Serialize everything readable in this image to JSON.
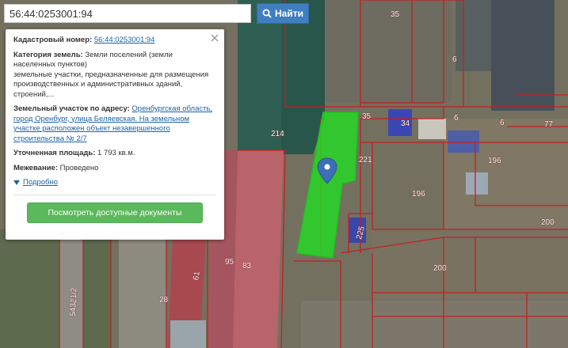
{
  "search": {
    "value": "56:44:0253001:94",
    "button_label": "Найти",
    "button_icon": "search-icon"
  },
  "popup": {
    "cadastral_label": "Кадастровый номер:",
    "cadastral_number": "56:44:0253001:94",
    "category_label": "Категория земель:",
    "category_value": "Земли поселений (земли населенных пунктов)",
    "category_detail": "земельные участки, предназначенные для размещения производственных и административных зданий, строений,...",
    "address_label": "Земельный участок по адресу:",
    "address_value": "Оренбургская область, город Оренбург, улица Беляевская. На земельном участке расположен объект незавершенного строительства № 2/7",
    "area_label": "Уточненная площадь:",
    "area_value": "1 793 кв.м.",
    "survey_label": "Межевание:",
    "survey_value": "Проведено",
    "more_label": "Подробно",
    "documents_button": "Посмотреть доступные документы",
    "close_icon": "close-icon"
  },
  "map": {
    "marker_icon": "map-marker-icon",
    "parcel_color": "#22dd22",
    "boundary_color": "#c41f24",
    "labels": [
      {
        "id": "35a",
        "text": "35"
      },
      {
        "id": "6a",
        "text": "6"
      },
      {
        "id": "6b",
        "text": "6"
      },
      {
        "id": "6c",
        "text": "6"
      },
      {
        "id": "77",
        "text": "77"
      },
      {
        "id": "35b",
        "text": "35"
      },
      {
        "id": "34",
        "text": "34"
      },
      {
        "id": "214",
        "text": "214"
      },
      {
        "id": "221",
        "text": "221"
      },
      {
        "id": "196a",
        "text": "196"
      },
      {
        "id": "196b",
        "text": "196"
      },
      {
        "id": "225",
        "text": "225"
      },
      {
        "id": "200a",
        "text": "200"
      },
      {
        "id": "200b",
        "text": "200"
      },
      {
        "id": "95",
        "text": "95"
      },
      {
        "id": "83",
        "text": "83"
      },
      {
        "id": "61",
        "text": "61"
      },
      {
        "id": "28",
        "text": "28"
      },
      {
        "id": "542712",
        "text": "54321/2"
      }
    ]
  }
}
